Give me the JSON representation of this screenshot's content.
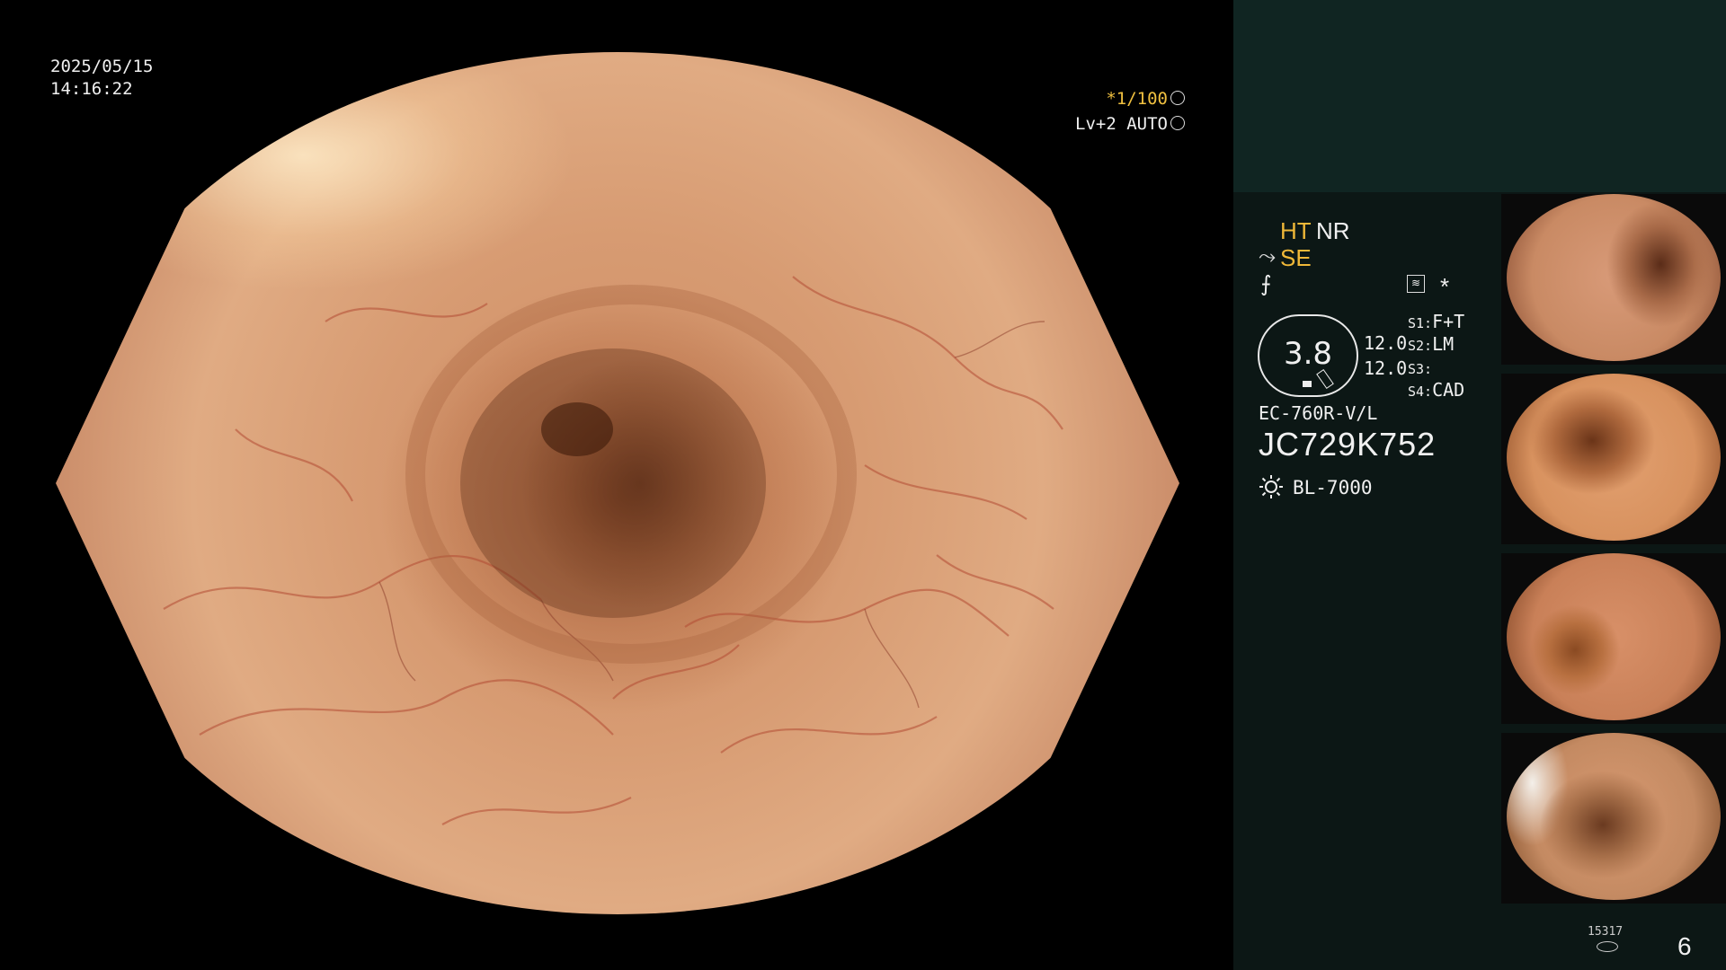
{
  "overlay": {
    "date": "2025/05/15",
    "time": "14:16:22",
    "zoom": "*1/100",
    "exposure": "Lv+2 AUTO"
  },
  "panel": {
    "ht": "HT",
    "nr": "NR",
    "se": "SE",
    "gauge_value": "3.8",
    "value_1": "12.0",
    "value_2": "12.0",
    "s1_key": "S1:",
    "s1_val": "F+T",
    "s2_key": "S2:",
    "s2_val": "LM",
    "s3_key": "S3:",
    "s3_val": "",
    "s4_key": "S4:",
    "s4_val": "CAD",
    "scope_model": "EC-760R-V/L",
    "serial_number": "JC729K752",
    "light_source": "BL-7000"
  },
  "footer": {
    "storage_count": "15317",
    "page_number": "6"
  },
  "icons": [
    "shutter-icon",
    "iris-icon",
    "structure-icon",
    "color-icon",
    "mode-icon",
    "star-icon",
    "light-icon",
    "storage-icon"
  ],
  "colors": {
    "accent": "#f0b838",
    "panel_bg": "#0c1715",
    "panel_top_bg": "#102522"
  }
}
